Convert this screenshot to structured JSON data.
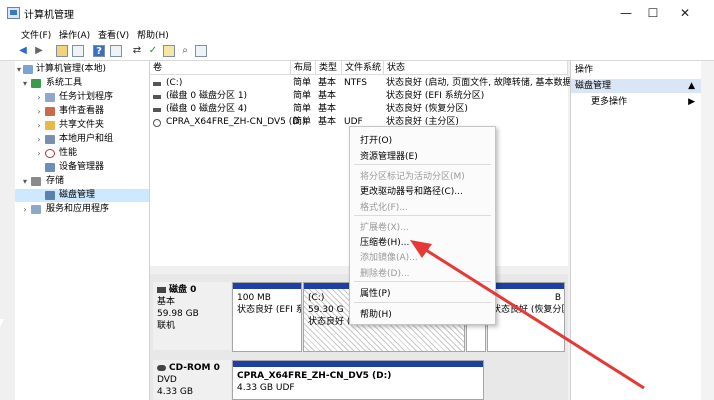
{
  "window": {
    "title": "计算机管理",
    "minimize": "—",
    "maximize": "☐",
    "close": "✕"
  },
  "menu": [
    "文件(F)",
    "操作(A)",
    "查看(V)",
    "帮助(H)"
  ],
  "tree": {
    "items": [
      {
        "label": "计算机管理(本地)",
        "arrow": "▾"
      },
      {
        "label": "系统工具",
        "arrow": "▾"
      },
      {
        "label": "任务计划程序",
        "arrow": "›"
      },
      {
        "label": "事件查看器",
        "arrow": "›"
      },
      {
        "label": "共享文件夹",
        "arrow": "›"
      },
      {
        "label": "本地用户和组",
        "arrow": "›"
      },
      {
        "label": "性能",
        "arrow": "›"
      },
      {
        "label": "设备管理器",
        "arrow": ""
      },
      {
        "label": "存储",
        "arrow": "▾"
      },
      {
        "label": "磁盘管理",
        "arrow": ""
      },
      {
        "label": "服务和应用程序",
        "arrow": "›"
      }
    ]
  },
  "volumes": {
    "headers": [
      "卷",
      "布局",
      "类型",
      "文件系统",
      "状态"
    ],
    "rows": [
      [
        "(C:)",
        "简单",
        "基本",
        "NTFS",
        "状态良好 (启动, 页面文件, 故障转储, 基本数据分区)"
      ],
      [
        "(磁盘 0 磁盘分区 1)",
        "简单",
        "基本",
        "",
        "状态良好 (EFI 系统分区)"
      ],
      [
        "(磁盘 0 磁盘分区 4)",
        "简单",
        "基本",
        "",
        "状态良好 (恢复分区)"
      ],
      [
        "CPRA_X64FRE_ZH-CN_DV5 (D:)",
        "简单",
        "基本",
        "UDF",
        "状态良好 (主分区)"
      ]
    ]
  },
  "disks": {
    "disk0": {
      "name": "磁盘 0",
      "type": "基本",
      "size": "59.98 GB",
      "status": "联机",
      "partitions": [
        {
          "title": "",
          "size": "100 MB",
          "status": "状态良好 (EFI 系"
        },
        {
          "title": "(C:)",
          "size": "59.30 G",
          "status": "状态良好 (启动, 页面文件, 故障转储, 基本"
        },
        {
          "title": "",
          "size": "",
          "status": ""
        },
        {
          "title": "",
          "size": "B",
          "status": "状态良好 (恢复分区)"
        }
      ]
    },
    "cdrom0": {
      "name": "CD-ROM 0",
      "type": "DVD",
      "size": "4.33 GB",
      "partition": {
        "title": "CPRA_X64FRE_ZH-CN_DV5 (D:)",
        "size": "4.33 GB UDF"
      }
    }
  },
  "actions": {
    "header": "操作",
    "section": "磁盘管理",
    "more": "更多操作",
    "up_arrow": "▲",
    "more_arrow": "▶"
  },
  "context_menu": {
    "items": [
      {
        "label": "打开(O)",
        "disabled": false
      },
      {
        "label": "资源管理器(E)",
        "disabled": false
      },
      {
        "label": "将分区标记为活动分区(M)",
        "disabled": true
      },
      {
        "label": "更改驱动器号和路径(C)...",
        "disabled": false
      },
      {
        "label": "格式化(F)...",
        "disabled": true
      },
      {
        "label": "扩展卷(X)...",
        "disabled": true
      },
      {
        "label": "压缩卷(H)...",
        "disabled": false
      },
      {
        "label": "添加镜像(A)...",
        "disabled": true
      },
      {
        "label": "删除卷(D)...",
        "disabled": true
      },
      {
        "label": "属性(P)",
        "disabled": false
      },
      {
        "label": "帮助(H)",
        "disabled": false
      }
    ]
  },
  "colors": {
    "partition_bar": "#1e3fa3",
    "annotation_arrow": "#e53935",
    "selection": "#cde8ff"
  }
}
